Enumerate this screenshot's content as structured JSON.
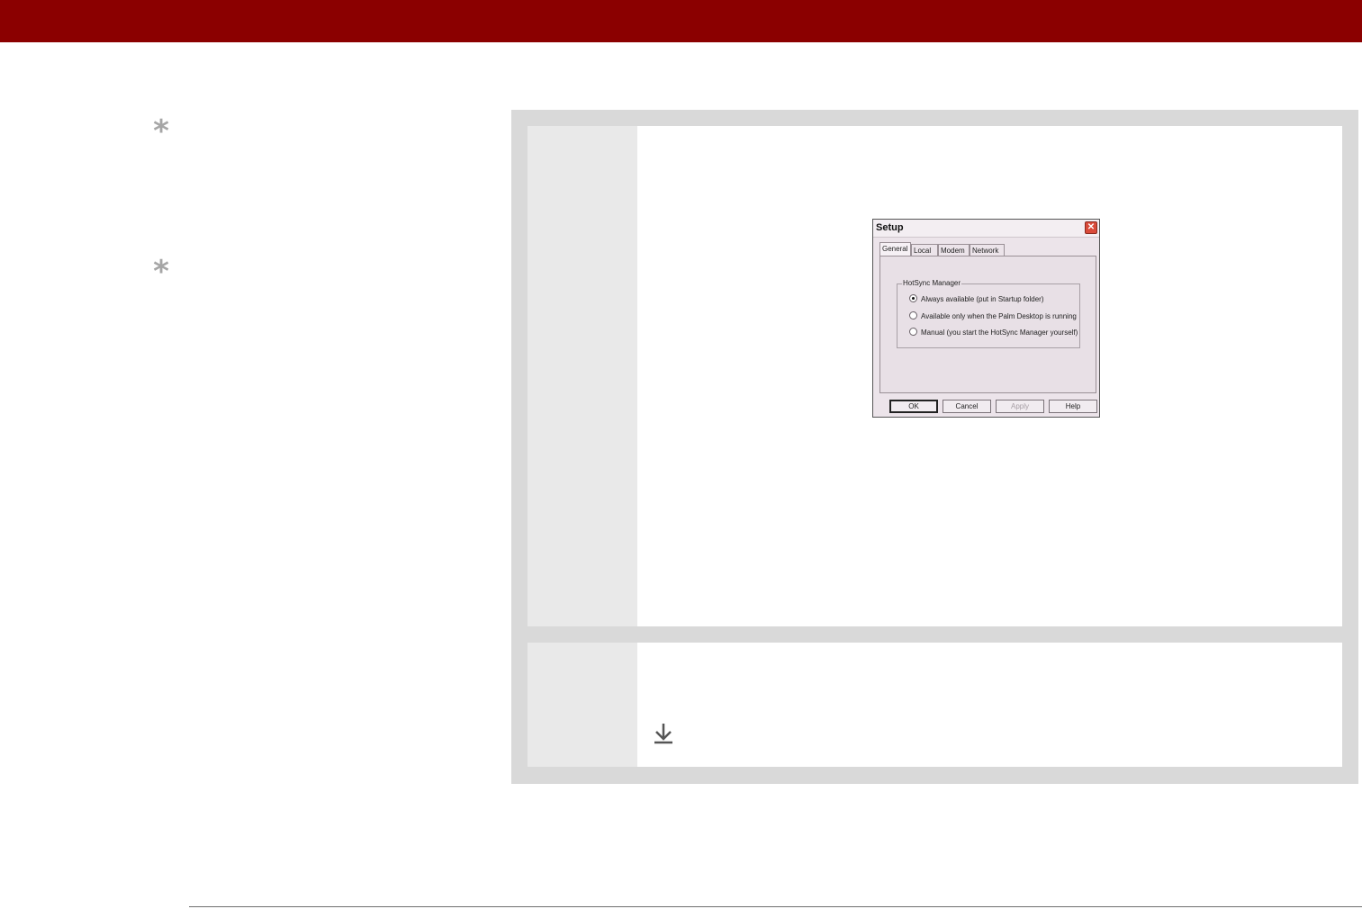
{
  "tips": [
    {
      "icon": "asterisk-tip-icon"
    },
    {
      "icon": "asterisk-tip-icon"
    }
  ],
  "dialog": {
    "title": "Setup",
    "tabs": [
      "General",
      "Local",
      "Modem",
      "Network"
    ],
    "active_tab": "General",
    "group_label": "HotSync Manager",
    "options": [
      "Always available (put in Startup folder)",
      "Available only when the Palm Desktop is running",
      "Manual (you start the HotSync Manager yourself)"
    ],
    "selected_option": "Always available (put in Startup folder)",
    "buttons": [
      "OK",
      "Cancel",
      "Apply",
      "Help"
    ],
    "disabled_button": "Apply"
  },
  "colors": {
    "header": "#8b0000",
    "panel": "#d9d9d9",
    "number_column": "#e9e9e9",
    "tip_icon": "#a6a6a6"
  },
  "icons": {
    "tip": "asterisk-icon",
    "download": "download-arrow-icon",
    "close": "close-icon"
  }
}
